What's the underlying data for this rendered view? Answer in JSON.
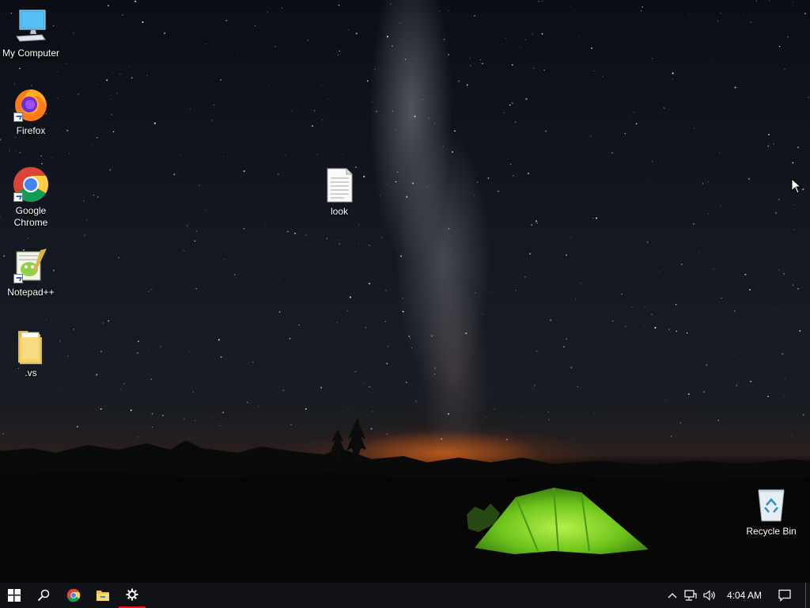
{
  "desktop": {
    "icons": [
      {
        "label": "My Computer",
        "icon": "computer-icon"
      },
      {
        "label": "Firefox",
        "icon": "firefox-icon"
      },
      {
        "label": "Google Chrome",
        "icon": "chrome-icon"
      },
      {
        "label": "Notepad++",
        "icon": "notepad-plus-plus-icon"
      },
      {
        "label": ".vs",
        "icon": "folder-icon"
      },
      {
        "label": "look",
        "icon": "text-file-icon"
      },
      {
        "label": "Recycle Bin",
        "icon": "recycle-bin-icon"
      }
    ]
  },
  "taskbar": {
    "start": "start-windows-icon",
    "search": "search-icon",
    "pinned": [
      "chrome-icon",
      "file-explorer-icon",
      "settings-gear-icon"
    ],
    "tray": [
      "chevron-up-icon",
      "network-icon",
      "volume-icon"
    ],
    "clock": "4:04 AM",
    "notifications": "action-center-icon"
  },
  "colors": {
    "accent": "#e81123",
    "taskbar": "#101216"
  }
}
